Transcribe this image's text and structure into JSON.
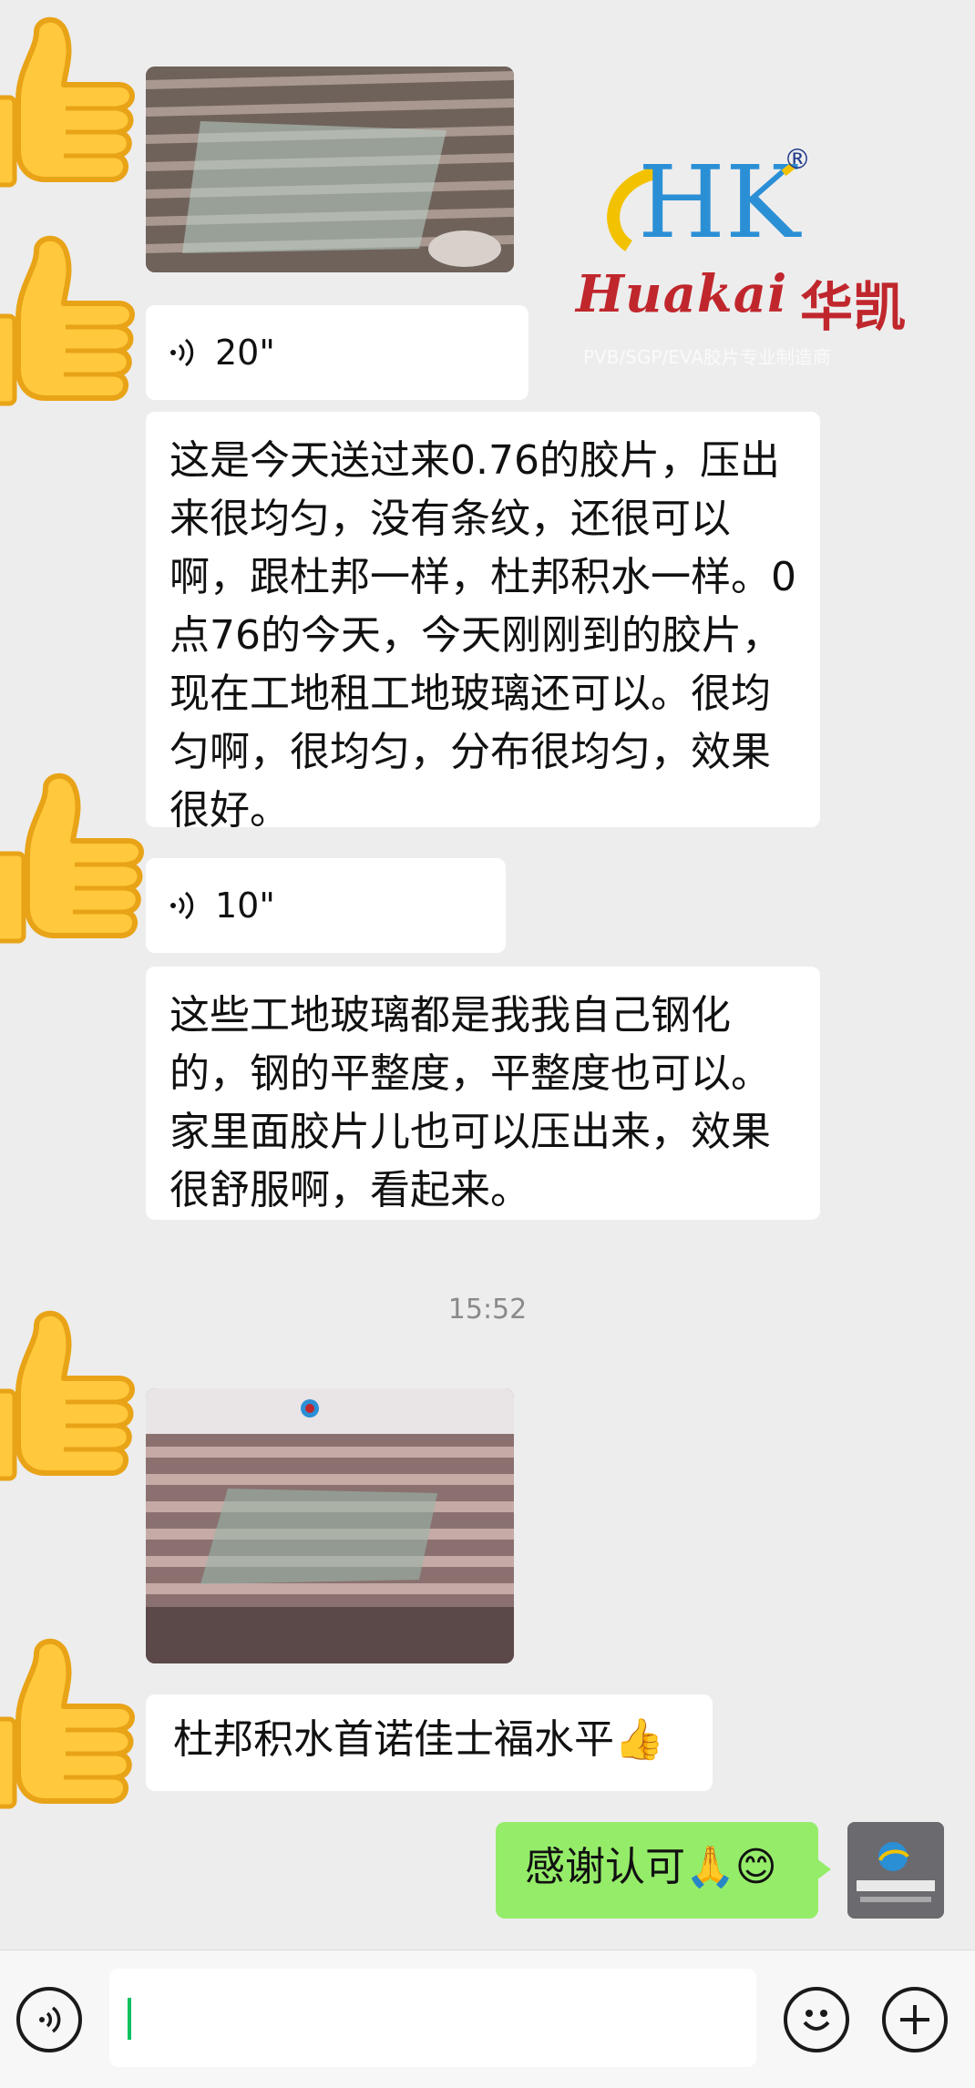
{
  "messages": {
    "voice_1_duration": "20\"",
    "text_1": "这是今天送过来0.76的胶片，压出来很均匀，没有条纹，还很可以啊，跟杜邦一样，杜邦积水一样。0点76的今天，今天刚刚到的胶片，现在工地租工地玻璃还可以。很均匀啊，很均匀，分布很均匀，效果很好。",
    "voice_2_duration": "10\"",
    "text_2": "这些工地玻璃都是我我自己钢化的，钢的平整度，平整度也可以。家里面胶片儿也可以压出来，效果很舒服啊，看起来。",
    "timestamp": "15:52",
    "text_3": "杜邦积水首诺佳士福水平👍",
    "reply": "感谢认可🙏😊"
  },
  "watermark": {
    "hk": "HK",
    "registered": "®",
    "brand_en": "Huakai",
    "brand_cn": "华凯",
    "tagline": "PVB/SGP/EVA胶片专业制造商"
  },
  "icons": {
    "avatar": "thumbs-up-icon",
    "voice_button": "voice-input-icon",
    "emoji_button": "emoji-icon",
    "more_button": "plus-icon"
  },
  "colors": {
    "background": "#ededed",
    "bubble_in": "#ffffff",
    "bubble_out": "#95ec69",
    "brand_red": "#c0272d",
    "brand_blue": "#223c8c"
  }
}
